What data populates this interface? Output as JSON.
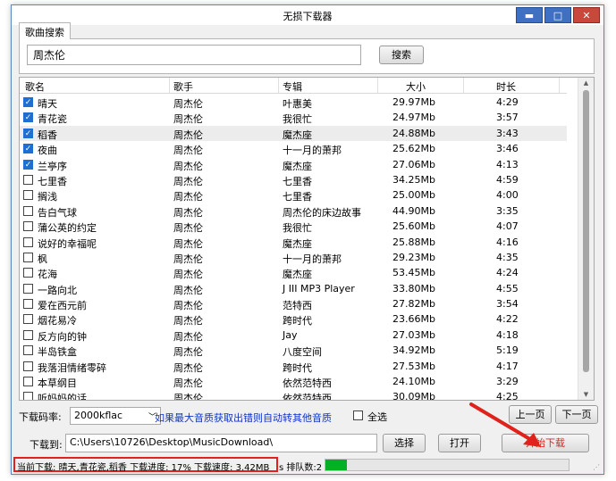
{
  "window": {
    "title": "无损下载器"
  },
  "tab": {
    "label": "歌曲搜索"
  },
  "search": {
    "value": "周杰伦",
    "button": "搜索"
  },
  "columns": [
    "歌名",
    "歌手",
    "专辑",
    "大小",
    "时长"
  ],
  "songs": [
    {
      "checked": true,
      "name": "晴天",
      "artist": "周杰伦",
      "album": "叶惠美",
      "size": "29.97Mb",
      "duration": "4:29"
    },
    {
      "checked": true,
      "name": "青花瓷",
      "artist": "周杰伦",
      "album": "我很忙",
      "size": "24.97Mb",
      "duration": "3:57"
    },
    {
      "checked": true,
      "name": "稻香",
      "artist": "周杰伦",
      "album": "魔杰座",
      "size": "24.88Mb",
      "duration": "3:43"
    },
    {
      "checked": true,
      "name": "夜曲",
      "artist": "周杰伦",
      "album": "十一月的萧邦",
      "size": "25.62Mb",
      "duration": "3:46"
    },
    {
      "checked": true,
      "name": "兰亭序",
      "artist": "周杰伦",
      "album": "魔杰座",
      "size": "27.06Mb",
      "duration": "4:13"
    },
    {
      "checked": false,
      "name": "七里香",
      "artist": "周杰伦",
      "album": "七里香",
      "size": "34.25Mb",
      "duration": "4:59"
    },
    {
      "checked": false,
      "name": "搁浅",
      "artist": "周杰伦",
      "album": "七里香",
      "size": "25.00Mb",
      "duration": "4:00"
    },
    {
      "checked": false,
      "name": "告白气球",
      "artist": "周杰伦",
      "album": "周杰伦的床边故事",
      "size": "44.90Mb",
      "duration": "3:35"
    },
    {
      "checked": false,
      "name": "蒲公英的约定",
      "artist": "周杰伦",
      "album": "我很忙",
      "size": "25.60Mb",
      "duration": "4:07"
    },
    {
      "checked": false,
      "name": "说好的幸福呢",
      "artist": "周杰伦",
      "album": "魔杰座",
      "size": "25.88Mb",
      "duration": "4:16"
    },
    {
      "checked": false,
      "name": "枫",
      "artist": "周杰伦",
      "album": "十一月的萧邦",
      "size": "29.23Mb",
      "duration": "4:35"
    },
    {
      "checked": false,
      "name": "花海",
      "artist": "周杰伦",
      "album": "魔杰座",
      "size": "53.45Mb",
      "duration": "4:24"
    },
    {
      "checked": false,
      "name": "一路向北",
      "artist": "周杰伦",
      "album": "J III MP3 Player",
      "size": "33.80Mb",
      "duration": "4:55"
    },
    {
      "checked": false,
      "name": "爱在西元前",
      "artist": "周杰伦",
      "album": "范特西",
      "size": "27.82Mb",
      "duration": "3:54"
    },
    {
      "checked": false,
      "name": "烟花易冷",
      "artist": "周杰伦",
      "album": "跨时代",
      "size": "23.66Mb",
      "duration": "4:22"
    },
    {
      "checked": false,
      "name": "反方向的钟",
      "artist": "周杰伦",
      "album": "Jay",
      "size": "27.03Mb",
      "duration": "4:18"
    },
    {
      "checked": false,
      "name": "半岛铁盒",
      "artist": "周杰伦",
      "album": "八度空间",
      "size": "34.92Mb",
      "duration": "5:19"
    },
    {
      "checked": false,
      "name": "我落泪情绪零碎",
      "artist": "周杰伦",
      "album": "跨时代",
      "size": "27.53Mb",
      "duration": "4:17"
    },
    {
      "checked": false,
      "name": "本草纲目",
      "artist": "周杰伦",
      "album": "依然范特西",
      "size": "24.10Mb",
      "duration": "3:29"
    },
    {
      "checked": false,
      "name": "听妈妈的话",
      "artist": "周杰伦",
      "album": "依然范特西",
      "size": "30.09Mb",
      "duration": "4:25"
    }
  ],
  "controls": {
    "rate_label": "下载码率:",
    "rate_value": "2000kflac",
    "hint": "如果最大音质获取出错则自动转其他音质",
    "select_all": "全选",
    "prev_page": "上一页",
    "next_page": "下一页",
    "path_label": "下载到:",
    "path_value": "C:\\Users\\10726\\Desktop\\MusicDownload\\",
    "browse": "选择",
    "open": "打开",
    "start": "开始下载"
  },
  "status": {
    "current": "当前下载: 晴天,青花瓷,稻香 下载进度: 17% 下载速度: 3.42MB",
    "queue": "s 排队数:2",
    "progress": 0.09
  }
}
